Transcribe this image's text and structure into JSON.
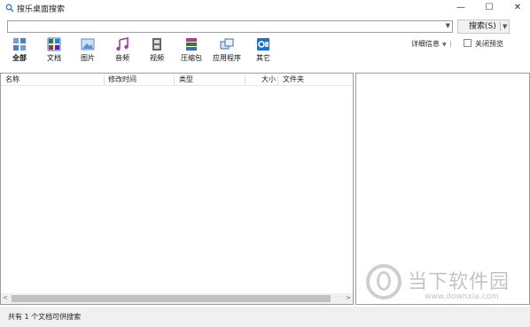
{
  "window": {
    "title": "搜乐桌面搜索",
    "icon": "search-icon",
    "minimize": "—",
    "maximize": "☐",
    "close": "✕"
  },
  "search": {
    "value": "",
    "placeholder": "",
    "button_label": "搜索(S)",
    "dropdown_glyph": "▼"
  },
  "categories": [
    {
      "label": "全部",
      "icon": "all-icon",
      "active": true,
      "color": "#2a6fb8"
    },
    {
      "label": "文档",
      "icon": "document-icon",
      "active": false,
      "color": "#3a7bc8"
    },
    {
      "label": "图片",
      "icon": "picture-icon",
      "active": false,
      "color": "#5b8fd0"
    },
    {
      "label": "音频",
      "icon": "music-note-icon",
      "active": false,
      "color": "#9c3fa8"
    },
    {
      "label": "视频",
      "icon": "film-icon",
      "active": false,
      "color": "#555555"
    },
    {
      "label": "压缩包",
      "icon": "archive-icon",
      "active": false,
      "color": "#b83a7a"
    },
    {
      "label": "应用程序",
      "icon": "application-icon",
      "active": false,
      "color": "#3a6fb0"
    },
    {
      "label": "其它",
      "icon": "outlook-icon",
      "active": false,
      "color": "#1f6fd1"
    }
  ],
  "toolbar": {
    "details_label": "详细信息",
    "details_arrow": "▼",
    "close_preview_label": "关闭预览"
  },
  "columns": [
    {
      "label": "名称"
    },
    {
      "label": "修改时间"
    },
    {
      "label": "类型"
    },
    {
      "label": "大小"
    },
    {
      "label": "文件夹"
    }
  ],
  "scroll": {
    "left_glyph": "<",
    "right_glyph": ">"
  },
  "status": {
    "text": "共有 1 个文档可供搜索"
  },
  "watermark": {
    "name": "当下软件园",
    "url": "www.downxia.com"
  }
}
